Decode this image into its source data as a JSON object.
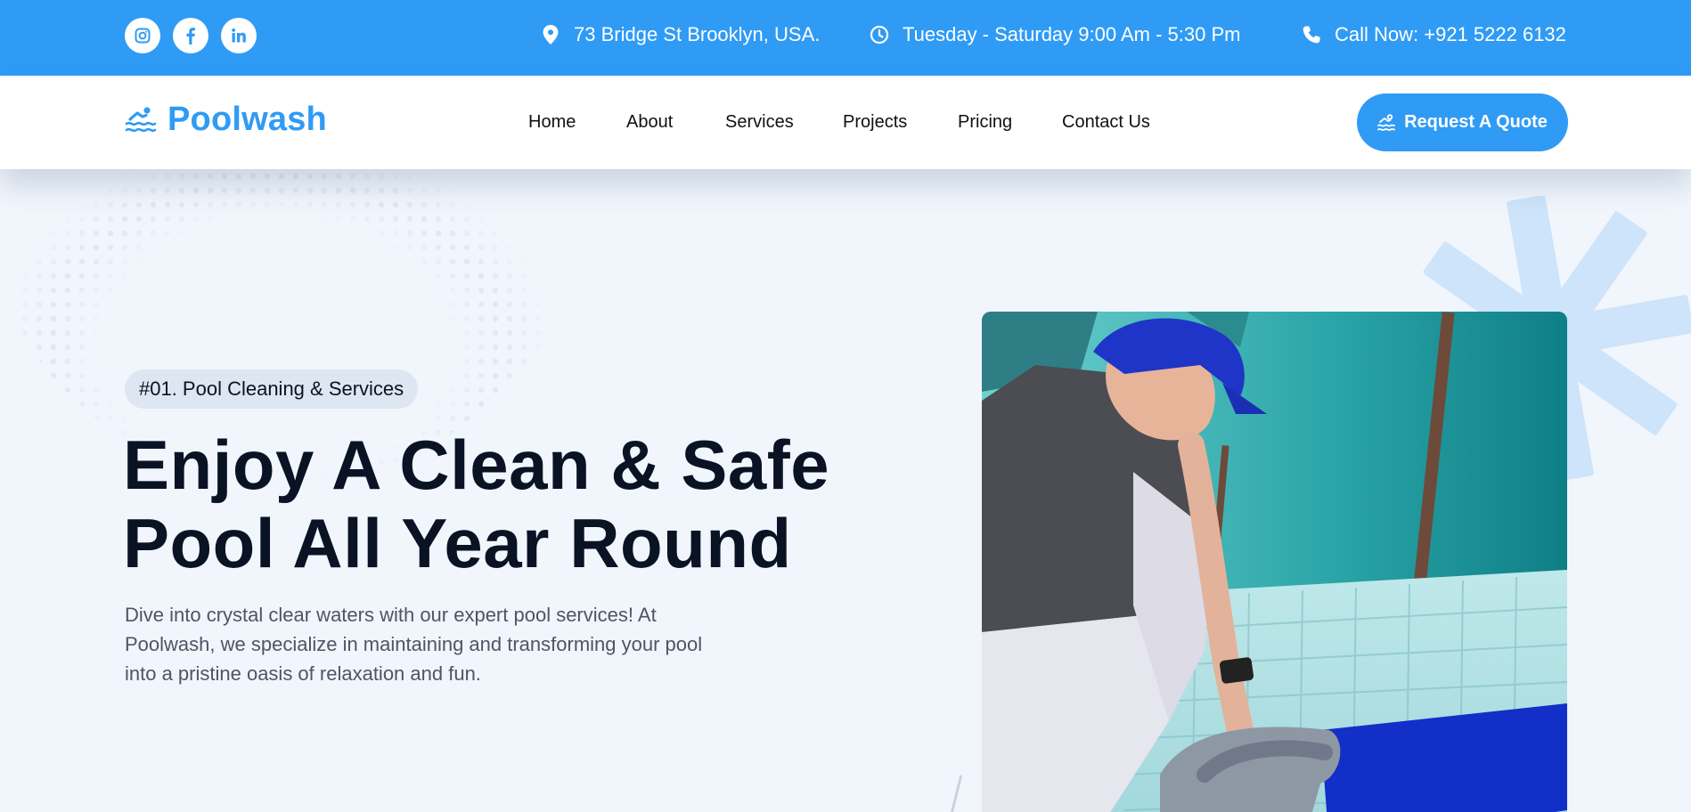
{
  "topbar": {
    "social": [
      {
        "name": "instagram-icon"
      },
      {
        "name": "facebook-icon"
      },
      {
        "name": "linkedin-icon"
      }
    ],
    "address": "73 Bridge St Brooklyn, USA.",
    "hours": "Tuesday - Saturday 9:00 Am - 5:30 Pm",
    "phone": "Call Now: +921 5222 6132"
  },
  "header": {
    "logo_text": "Poolwash",
    "nav": [
      "Home",
      "About",
      "Services",
      "Projects",
      "Pricing",
      "Contact Us"
    ],
    "cta": "Request A Quote"
  },
  "hero": {
    "badge": "#01. Pool Cleaning & Services",
    "headline_line1": "Enjoy A Clean & Safe",
    "headline_line2": "Pool All Year Round",
    "description": "Dive into crystal clear waters with our expert pool services! At Poolwash, we specialize in maintaining and transforming your pool into a pristine oasis of relaxation and fun."
  },
  "colors": {
    "primary": "#2f9bf5",
    "heading": "#0a1324",
    "background": "#f1f6fc"
  }
}
